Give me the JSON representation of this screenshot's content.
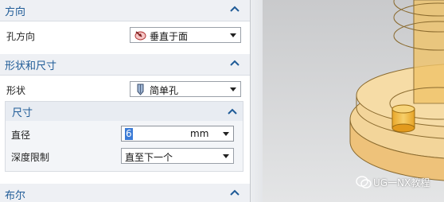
{
  "panel": {
    "direction_section": {
      "title": "方向",
      "hole_direction_label": "孔方向",
      "hole_direction_value": "垂直于面"
    },
    "form_section": {
      "title": "形状和尺寸",
      "shape_label": "形状",
      "shape_value": "简单孔",
      "dimensions": {
        "title": "尺寸",
        "diameter_label": "直径",
        "diameter_value": "6",
        "diameter_unit": "mm",
        "depth_limit_label": "深度限制",
        "depth_limit_value": "直至下一个"
      }
    },
    "boolean_section": {
      "title": "布尔"
    }
  },
  "watermark": {
    "text": "UG一NX教程"
  },
  "colors": {
    "section_title": "#1f5b97",
    "model_fill": "#f0b030",
    "selection": "#3b7bd6"
  }
}
